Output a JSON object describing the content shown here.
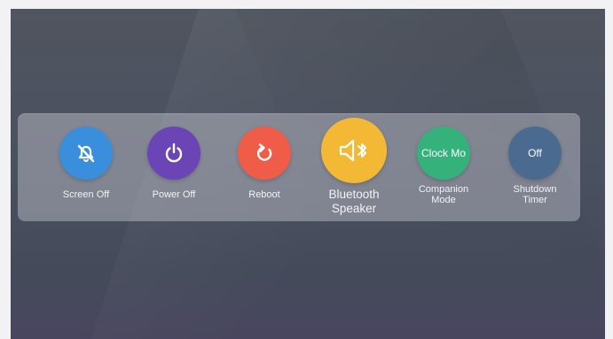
{
  "panel": {
    "buttons": [
      {
        "label": "Screen Off",
        "icon": "screen-off-icon",
        "color": "#3a8fdc"
      },
      {
        "label": "Power Off",
        "icon": "power-icon",
        "color": "#6b44b6"
      },
      {
        "label": "Reboot",
        "icon": "reboot-icon",
        "color": "#ef5c48"
      },
      {
        "label": "Bluetooth\nSpeaker",
        "icon": "bluetooth-speaker-icon",
        "color": "#f3b934"
      },
      {
        "label": "Companion\nMode",
        "circle_text": "Clock Mo",
        "color": "#35b27c"
      },
      {
        "label": "Shutdown\nTimer",
        "circle_text": "Off",
        "color": "#4a6a8f"
      }
    ]
  }
}
